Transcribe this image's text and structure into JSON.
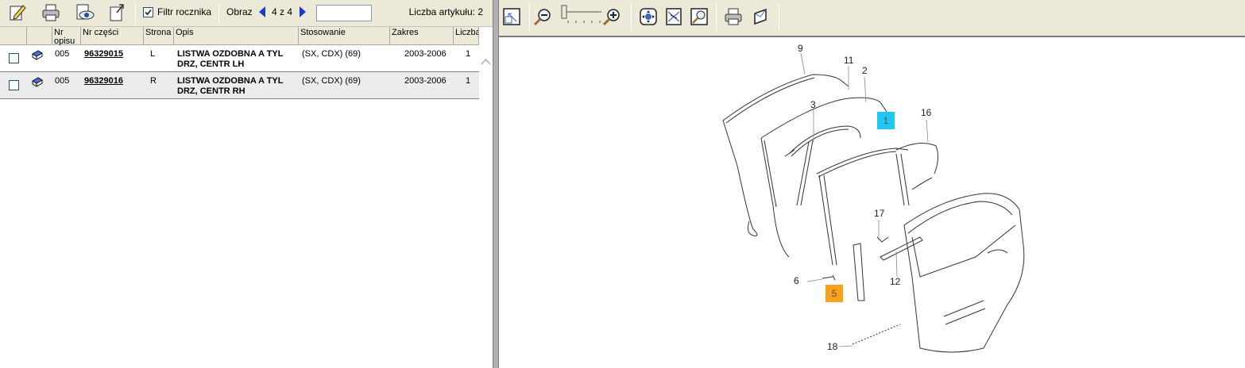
{
  "left_toolbar": {
    "icons": [
      "edit-icon",
      "print-icon",
      "preview-icon",
      "export-icon"
    ],
    "filter_label": "Filtr rocznika",
    "filter_checked": true,
    "obraz_label": "Obraz",
    "page_info": "4 z 4",
    "search_value": "",
    "count_label": "Liczba artykułu: 2"
  },
  "table": {
    "columns": [
      "Nr opisu",
      "Nr części",
      "Strona",
      "Opis",
      "Stosowanie",
      "Zakres",
      "Liczba"
    ],
    "rows": [
      {
        "nr_opisu": "005",
        "nr_czesci": "96329015",
        "strona": "L",
        "opis_1": "LISTWA OZDOBNA A TYL",
        "opis_2": "DRZ, CENTR LH",
        "stosowanie": "(SX, CDX) (69)",
        "zakres": "2003-2006",
        "liczba": "1"
      },
      {
        "nr_opisu": "005",
        "nr_czesci": "96329016",
        "strona": "R",
        "opis_1": "LISTWA OZDOBNA A TYL",
        "opis_2": "DRZ, CENTR RH",
        "stosowanie": "(SX, CDX) (69)",
        "zakres": "2003-2006",
        "liczba": "1"
      }
    ]
  },
  "right_toolbar": {
    "icons": [
      "fit-page-icon",
      "zoom-out-icon",
      "zoom-slider",
      "zoom-in-icon",
      "pan-icon",
      "fit-width-icon",
      "zoom-area-icon",
      "print-icon",
      "send-icon"
    ]
  },
  "diagram": {
    "callouts": [
      "9",
      "11",
      "2",
      "3",
      "16",
      "17",
      "6",
      "12",
      "18"
    ],
    "highlight_blue": "1",
    "highlight_orange": "5",
    "colors": {
      "highlight_blue": "#1ec8f0",
      "highlight_orange": "#f7a21a"
    }
  }
}
